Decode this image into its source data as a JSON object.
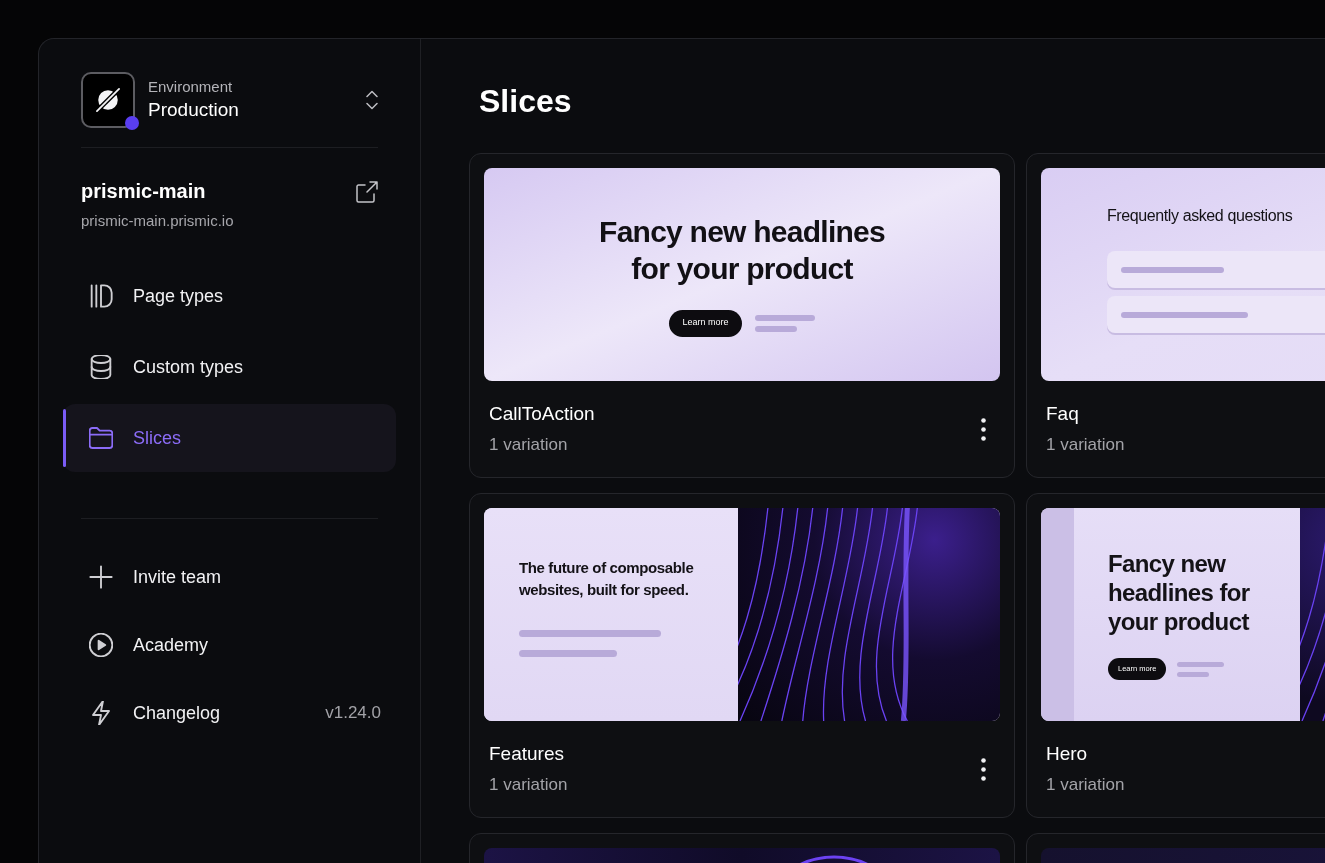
{
  "environment": {
    "label": "Environment",
    "name": "Production"
  },
  "repository": {
    "name": "prismic-main",
    "url": "prismic-main.prismic.io"
  },
  "nav": [
    {
      "kind": "columns",
      "label": "Page types",
      "selected": false
    },
    {
      "kind": "database",
      "label": "Custom types",
      "selected": false
    },
    {
      "kind": "folder",
      "label": "Slices",
      "selected": true
    }
  ],
  "links": [
    {
      "kind": "plus",
      "label": "Invite team"
    },
    {
      "kind": "play",
      "label": "Academy"
    },
    {
      "kind": "bolt",
      "label": "Changelog",
      "version": "v1.24.0"
    }
  ],
  "page_title": "Slices",
  "slices": [
    {
      "name": "CallToAction",
      "variations": "1 variation",
      "menu": true,
      "preview": {
        "kind": "cta",
        "headline": "Fancy new headlines for your product",
        "button": "Learn more"
      }
    },
    {
      "name": "Faq",
      "variations": "1 variation",
      "preview": {
        "kind": "faq",
        "headline": "Frequently asked questions"
      }
    },
    {
      "name": "Features",
      "variations": "1 variation",
      "menu": true,
      "preview": {
        "kind": "features",
        "headline": "The future of composable websites, built for speed."
      }
    },
    {
      "name": "Hero",
      "variations": "1 variation",
      "preview": {
        "kind": "hero",
        "headline": "Fancy new headlines for your product",
        "button": "Learn more"
      }
    },
    {
      "preview": {
        "kind": "orb"
      }
    },
    {
      "preview": {
        "kind": "dark"
      }
    }
  ]
}
